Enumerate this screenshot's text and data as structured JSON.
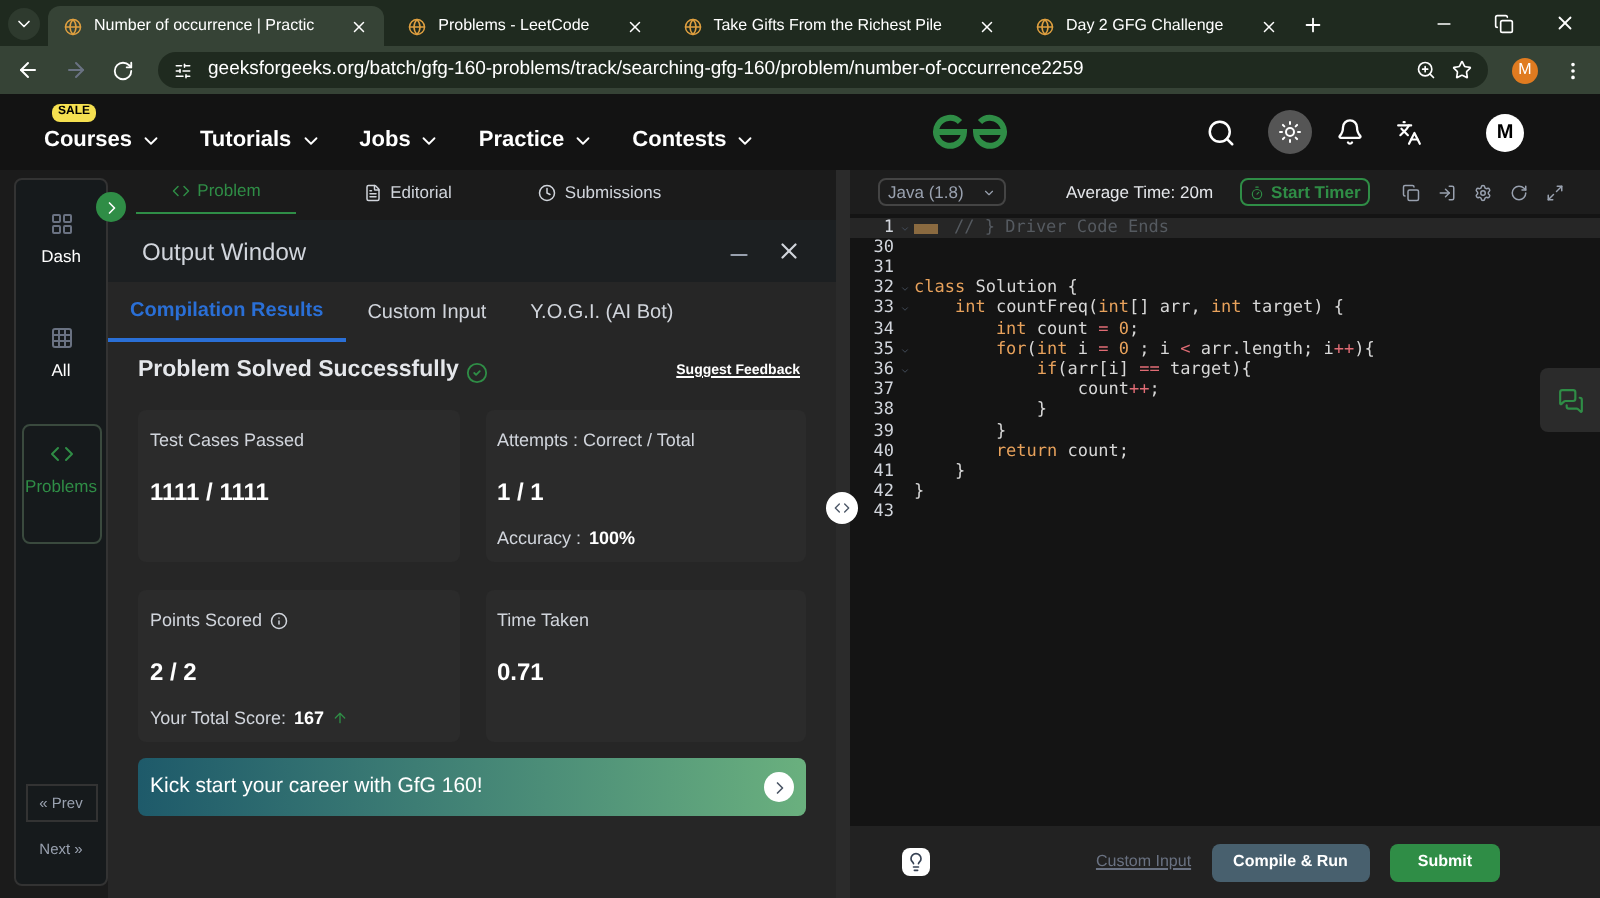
{
  "browser": {
    "tabs": [
      {
        "label": "Number of occurrence | Practic",
        "selected": true
      },
      {
        "label": "Problems - LeetCode",
        "selected": false
      },
      {
        "label": "Take Gifts From the Richest Pile",
        "selected": false
      },
      {
        "label": "Day 2 GFG Challenge",
        "selected": false
      }
    ],
    "url": "geeksforgeeks.org/batch/gfg-160-problems/track/searching-gfg-160/problem/number-of-occurrence2259",
    "profile": "M"
  },
  "nav": {
    "sale_badge": "SALE",
    "items": [
      "Courses",
      "Tutorials",
      "Jobs",
      "Practice",
      "Contests"
    ],
    "avatar": "M"
  },
  "sidebar": {
    "items": [
      {
        "label": "Dash",
        "selected": false
      },
      {
        "label": "All",
        "selected": false
      },
      {
        "label": "Problems",
        "selected": true
      }
    ],
    "prev": "« Prev",
    "next": "Next »"
  },
  "problem_tabs": [
    {
      "label": "Problem",
      "selected": true
    },
    {
      "label": "Editorial",
      "selected": false
    },
    {
      "label": "Submissions",
      "selected": false
    }
  ],
  "output": {
    "title": "Output Window",
    "tabs": [
      {
        "label": "Compilation Results",
        "selected": true
      },
      {
        "label": "Custom Input",
        "selected": false
      },
      {
        "label": "Y.O.G.I. (AI Bot)",
        "selected": false
      }
    ],
    "status": "Problem Solved Successfully",
    "feedback": "Suggest Feedback",
    "cards": [
      {
        "label": "Test Cases Passed",
        "value": "1111 / 1111"
      },
      {
        "label": "Attempts : Correct / Total",
        "value": "1 / 1",
        "note_label": "Accuracy :",
        "note_value": "100%"
      },
      {
        "label": "Points Scored",
        "value": "2 / 2",
        "note_label": "Your Total Score:",
        "note_value": "167",
        "info": true,
        "trend": true
      },
      {
        "label": "Time Taken",
        "value": "0.71"
      }
    ],
    "banner": "Kick start your career with GfG 160!"
  },
  "editor": {
    "language": "Java (1.8)",
    "average_time": "Average Time: 20m",
    "timer": "Start Timer",
    "lines": [
      {
        "num": "1",
        "fold": true,
        "highlight": true,
        "segments": [
          {
            "text": "// } Driver Code Ends",
            "kind": "comment"
          }
        ]
      },
      {
        "num": "30",
        "fold": false,
        "highlight": false
      },
      {
        "num": "31",
        "fold": false,
        "highlight": false
      },
      {
        "num": "32",
        "fold": true,
        "highlight": false,
        "segments": [
          {
            "text": "class",
            "kind": "keyword"
          },
          {
            "text": " Solution {",
            "kind": "plain"
          }
        ]
      },
      {
        "num": "33",
        "fold": true,
        "highlight": false,
        "segments": [
          {
            "text": "    int",
            "kind": "keyword"
          },
          {
            "text": " countFreq(",
            "kind": "plain"
          },
          {
            "text": "int",
            "kind": "keyword"
          },
          {
            "text": "[] arr, ",
            "kind": "plain"
          },
          {
            "text": "int",
            "kind": "keyword"
          },
          {
            "text": " target) {",
            "kind": "plain"
          }
        ]
      },
      {
        "num": "34",
        "fold": false,
        "highlight": false,
        "segments": [
          {
            "text": "        int",
            "kind": "keyword"
          },
          {
            "text": " count ",
            "kind": "plain"
          },
          {
            "text": "=",
            "kind": "operator"
          },
          {
            "text": " 0",
            "kind": "number"
          },
          {
            "text": ";",
            "kind": "plain"
          }
        ]
      },
      {
        "num": "35",
        "fold": true,
        "highlight": false,
        "segments": [
          {
            "text": "        for",
            "kind": "keyword"
          },
          {
            "text": "(",
            "kind": "plain"
          },
          {
            "text": "int",
            "kind": "keyword"
          },
          {
            "text": " i ",
            "kind": "plain"
          },
          {
            "text": "=",
            "kind": "operator"
          },
          {
            "text": " 0",
            "kind": "number"
          },
          {
            "text": " ; i ",
            "kind": "plain"
          },
          {
            "text": "<",
            "kind": "operator"
          },
          {
            "text": " arr.length; i",
            "kind": "plain"
          },
          {
            "text": "++",
            "kind": "operator"
          },
          {
            "text": "){",
            "kind": "plain"
          }
        ]
      },
      {
        "num": "36",
        "fold": true,
        "highlight": false,
        "segments": [
          {
            "text": "            if",
            "kind": "keyword"
          },
          {
            "text": "(arr[i] ",
            "kind": "plain"
          },
          {
            "text": "==",
            "kind": "operator"
          },
          {
            "text": " target){",
            "kind": "plain"
          }
        ]
      },
      {
        "num": "37",
        "fold": false,
        "highlight": false,
        "segments": [
          {
            "text": "                count",
            "kind": "plain"
          },
          {
            "text": "++",
            "kind": "operator"
          },
          {
            "text": ";",
            "kind": "plain"
          }
        ]
      },
      {
        "num": "38",
        "fold": false,
        "highlight": false,
        "segments": [
          {
            "text": "            }",
            "kind": "plain"
          }
        ]
      },
      {
        "num": "39",
        "fold": false,
        "highlight": false,
        "segments": [
          {
            "text": "        }",
            "kind": "plain"
          }
        ]
      },
      {
        "num": "40",
        "fold": false,
        "highlight": false,
        "segments": [
          {
            "text": "        return",
            "kind": "keyword"
          },
          {
            "text": " count;",
            "kind": "plain"
          }
        ]
      },
      {
        "num": "41",
        "fold": false,
        "highlight": false,
        "segments": [
          {
            "text": "    }",
            "kind": "plain"
          }
        ]
      },
      {
        "num": "42",
        "fold": false,
        "highlight": false,
        "segments": [
          {
            "text": "}",
            "kind": "plain"
          }
        ]
      },
      {
        "num": "43",
        "fold": false,
        "highlight": false
      }
    ],
    "custom_input": "Custom Input",
    "compile": "Compile & Run",
    "submit": "Submit"
  }
}
